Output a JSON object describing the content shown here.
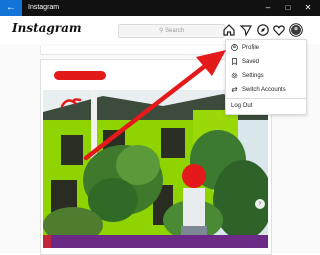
{
  "window": {
    "title": "Instagram",
    "back_icon": "back-arrow-icon",
    "controls": [
      "minimize-icon",
      "maximize-icon",
      "close-icon"
    ]
  },
  "header": {
    "logo": "Instagram",
    "search_placeholder": "Search",
    "icons": [
      "home-icon",
      "direct-message-icon",
      "explore-icon",
      "activity-heart-icon",
      "profile-avatar-icon"
    ]
  },
  "menu": {
    "items": [
      {
        "label": "Profile",
        "icon": "profile-icon"
      },
      {
        "label": "Saved",
        "icon": "bookmark-icon"
      },
      {
        "label": "Settings",
        "icon": "gear-icon"
      },
      {
        "label": "Switch Accounts",
        "icon": "switch-icon"
      }
    ],
    "logout": "Log Out"
  },
  "colors": {
    "titlebar": "#111111",
    "back_button": "#1473d6",
    "annotation_red": "#e41a1a",
    "building_green": "#8fd400"
  }
}
